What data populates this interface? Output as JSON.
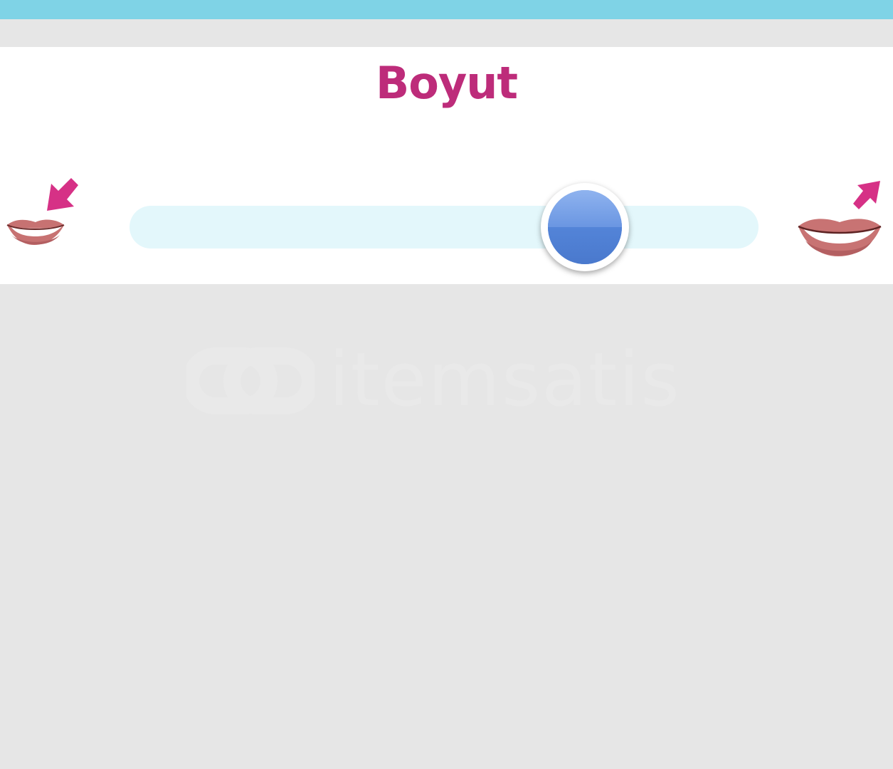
{
  "header": {
    "color": "#7fd3e6"
  },
  "panel": {
    "title": "Boyut",
    "title_color": "#bd2c7a"
  },
  "slider": {
    "value_fraction": 0.74,
    "track_color": "#e3f7fb",
    "thumb_color": "#5d8ee0",
    "min_icon": "small-lips-icon",
    "max_icon": "large-lips-icon",
    "shrink_icon": "shrink-arrow-icon",
    "grow_icon": "grow-arrow-icon"
  },
  "watermark": {
    "text": "itemsatis"
  }
}
